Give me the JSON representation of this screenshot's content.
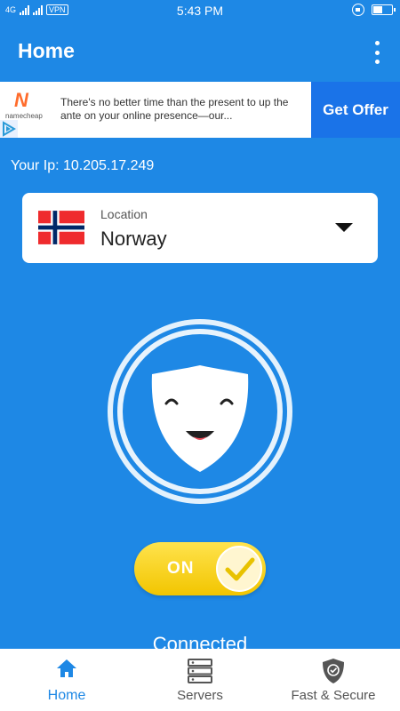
{
  "status_bar": {
    "network": "4G",
    "vpn_badge": "VPN",
    "time": "5:43 PM"
  },
  "header": {
    "title": "Home"
  },
  "ad": {
    "brand": "namecheap",
    "text": "There's no better time than the present to up the ante on your online presence—our...",
    "cta": "Get Offer"
  },
  "connection": {
    "ip_text": "Your Ip: 10.205.17.249",
    "location_label": "Location",
    "location_value": "Norway",
    "toggle_label": "ON",
    "status": "Connected"
  },
  "bottom_nav": {
    "items": [
      {
        "label": "Home",
        "icon": "home-icon",
        "active": true
      },
      {
        "label": "Servers",
        "icon": "servers-icon",
        "active": false
      },
      {
        "label": "Fast & Secure",
        "icon": "shield-check-icon",
        "active": false
      }
    ]
  },
  "colors": {
    "primary": "#1e88e5",
    "ad_button": "#1a73e8",
    "toggle": "#f2c500",
    "active_nav": "#1e88e5"
  }
}
